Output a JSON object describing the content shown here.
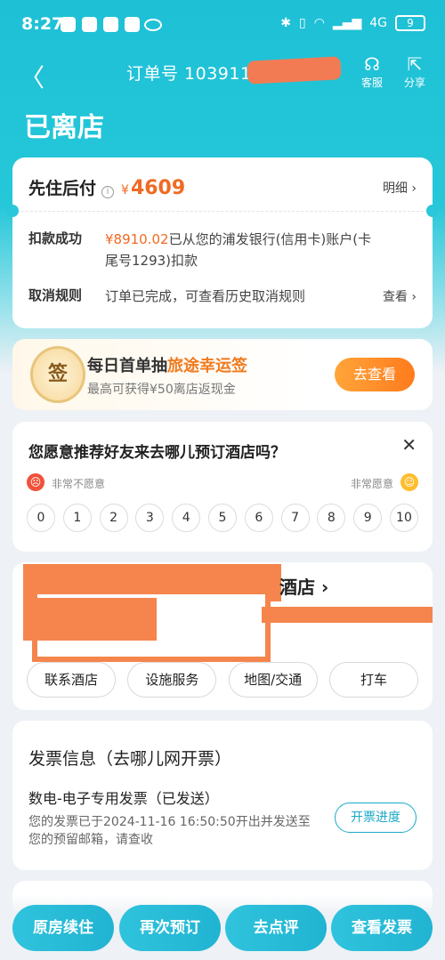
{
  "status_bar": {
    "time": "8:27",
    "signal": "4G",
    "battery": "9"
  },
  "nav": {
    "back_icon": "back-arrow-icon",
    "title": "订单号 103911",
    "service_label": "客服",
    "share_label": "分享"
  },
  "order_status": "已离店",
  "payment": {
    "title": "先住后付",
    "currency": "¥",
    "amount": "4609",
    "detail_link": "明细",
    "deduct_label": "扣款成功",
    "deduct_amount": "¥8910.02",
    "deduct_text": "已从您的浦发银行(信用卡)账户(卡尾号1293)扣款",
    "cancel_label": "取消规则",
    "cancel_text": "订单已完成，可查看历史取消规则",
    "cancel_link": "查看"
  },
  "lottery": {
    "badge": "签",
    "title_prefix": "每日首单抽",
    "title_highlight": "旅途幸运签",
    "subtitle": "最高可获得¥50离店返现金",
    "button": "去查看"
  },
  "survey": {
    "question": "您愿意推荐好友来去哪儿预订酒店吗？",
    "low_label": "非常不愿意",
    "high_label": "非常愿意",
    "scale": [
      "0",
      "1",
      "2",
      "3",
      "4",
      "5",
      "6",
      "7",
      "8",
      "9",
      "10"
    ]
  },
  "hotel": {
    "name_visible": "酒店",
    "buttons": [
      "联系酒店",
      "设施服务",
      "地图/交通",
      "打车"
    ]
  },
  "invoice": {
    "heading": "发票信息（去哪儿网开票）",
    "type": "数电-电子专用发票（已发送）",
    "description": "您的发票已于2024-11-16 16:50:50开出并发送至您的预留邮箱，请查收",
    "progress_button": "开票进度"
  },
  "bottom_actions": [
    "原房续住",
    "再次预订",
    "去点评",
    "查看发票"
  ]
}
